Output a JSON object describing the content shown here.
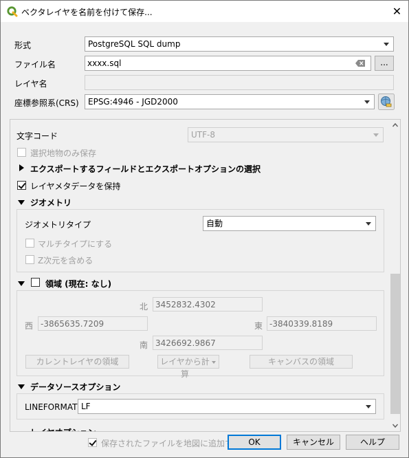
{
  "window": {
    "title": "ベクタレイヤを名前を付けて保存...",
    "close_icon": "close-icon",
    "app_icon": "qgis-icon"
  },
  "form": {
    "format_label": "形式",
    "format_value": "PostgreSQL SQL dump",
    "filename_label": "ファイル名",
    "filename_value": "xxxx.sql",
    "browse_label": "...",
    "layer_label": "レイヤ名",
    "layer_value": "",
    "crs_label": "座標参照系(CRS)",
    "crs_value": "EPSG:4946 - JGD2000"
  },
  "options": {
    "encoding_label": "文字コード",
    "encoding_value": "UTF-8",
    "selected_only_label": "選択地物のみ保存",
    "export_fields_label": "エクスポートするフィールドとエクスポートオプションの選択",
    "keep_metadata_label": "レイヤメタデータを保持",
    "geometry": {
      "header": "ジオメトリ",
      "type_label": "ジオメトリタイプ",
      "type_value": "自動",
      "multi_label": "マルチタイプにする",
      "z_label": "Z次元を含める"
    },
    "extent": {
      "header": "領域 (現在: なし)",
      "north_label": "北",
      "north_value": "3452832.4302",
      "west_label": "西",
      "west_value": "-3865635.7209",
      "east_label": "東",
      "east_value": "-3840339.8189",
      "south_label": "南",
      "south_value": "3426692.9867",
      "current_layer_btn": "カレントレイヤの領域",
      "calc_from_layer_btn": "レイヤから計算",
      "canvas_btn": "キャンバスの領域"
    },
    "datasource": {
      "header": "データソースオプション",
      "lineformat_label": "LINEFORMAT",
      "lineformat_value": "LF"
    },
    "layer_options_header": "レイヤオプション"
  },
  "footer": {
    "add_to_map_label": "保存されたファイルを地図に追加する",
    "ok": "OK",
    "cancel": "キャンセル",
    "help": "ヘルプ"
  }
}
